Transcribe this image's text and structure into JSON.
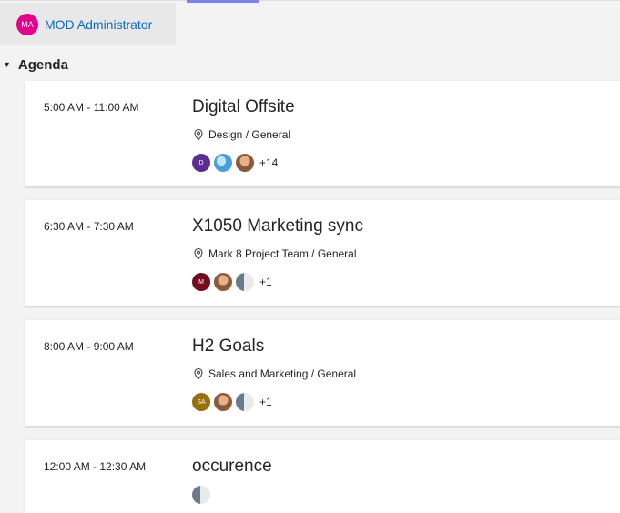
{
  "user": {
    "initials": "MA",
    "name": "MOD Administrator"
  },
  "agenda": {
    "title": "Agenda"
  },
  "events": [
    {
      "time": "5:00 AM - 11:00 AM",
      "title": "Digital Offsite",
      "location": "Design / General",
      "attendees": [
        {
          "type": "initials",
          "text": "D",
          "color": "#5c2d91"
        },
        {
          "type": "photo",
          "icon": "globe-avatar"
        },
        {
          "type": "photo",
          "icon": "person-photo"
        }
      ],
      "more": "+14"
    },
    {
      "time": "6:30 AM - 7:30 AM",
      "title": "X1050 Marketing sync",
      "location": "Mark 8 Project Team / General",
      "attendees": [
        {
          "type": "initials",
          "text": "M",
          "color": "#750b1c"
        },
        {
          "type": "photo",
          "icon": "person-photo"
        },
        {
          "type": "photo",
          "icon": "person-photo-2"
        }
      ],
      "more": "+1"
    },
    {
      "time": "8:00 AM - 9:00 AM",
      "title": "H2 Goals",
      "location": "Sales and Marketing / General",
      "attendees": [
        {
          "type": "initials",
          "text": "SA",
          "color": "#986f0b"
        },
        {
          "type": "photo",
          "icon": "person-photo"
        },
        {
          "type": "photo",
          "icon": "person-photo-2"
        }
      ],
      "more": "+1"
    },
    {
      "time": "12:00 AM - 12:30 AM",
      "title": "occurence",
      "location": "",
      "attendees": [
        {
          "type": "photo",
          "icon": "person-photo-2"
        }
      ],
      "more": ""
    }
  ]
}
